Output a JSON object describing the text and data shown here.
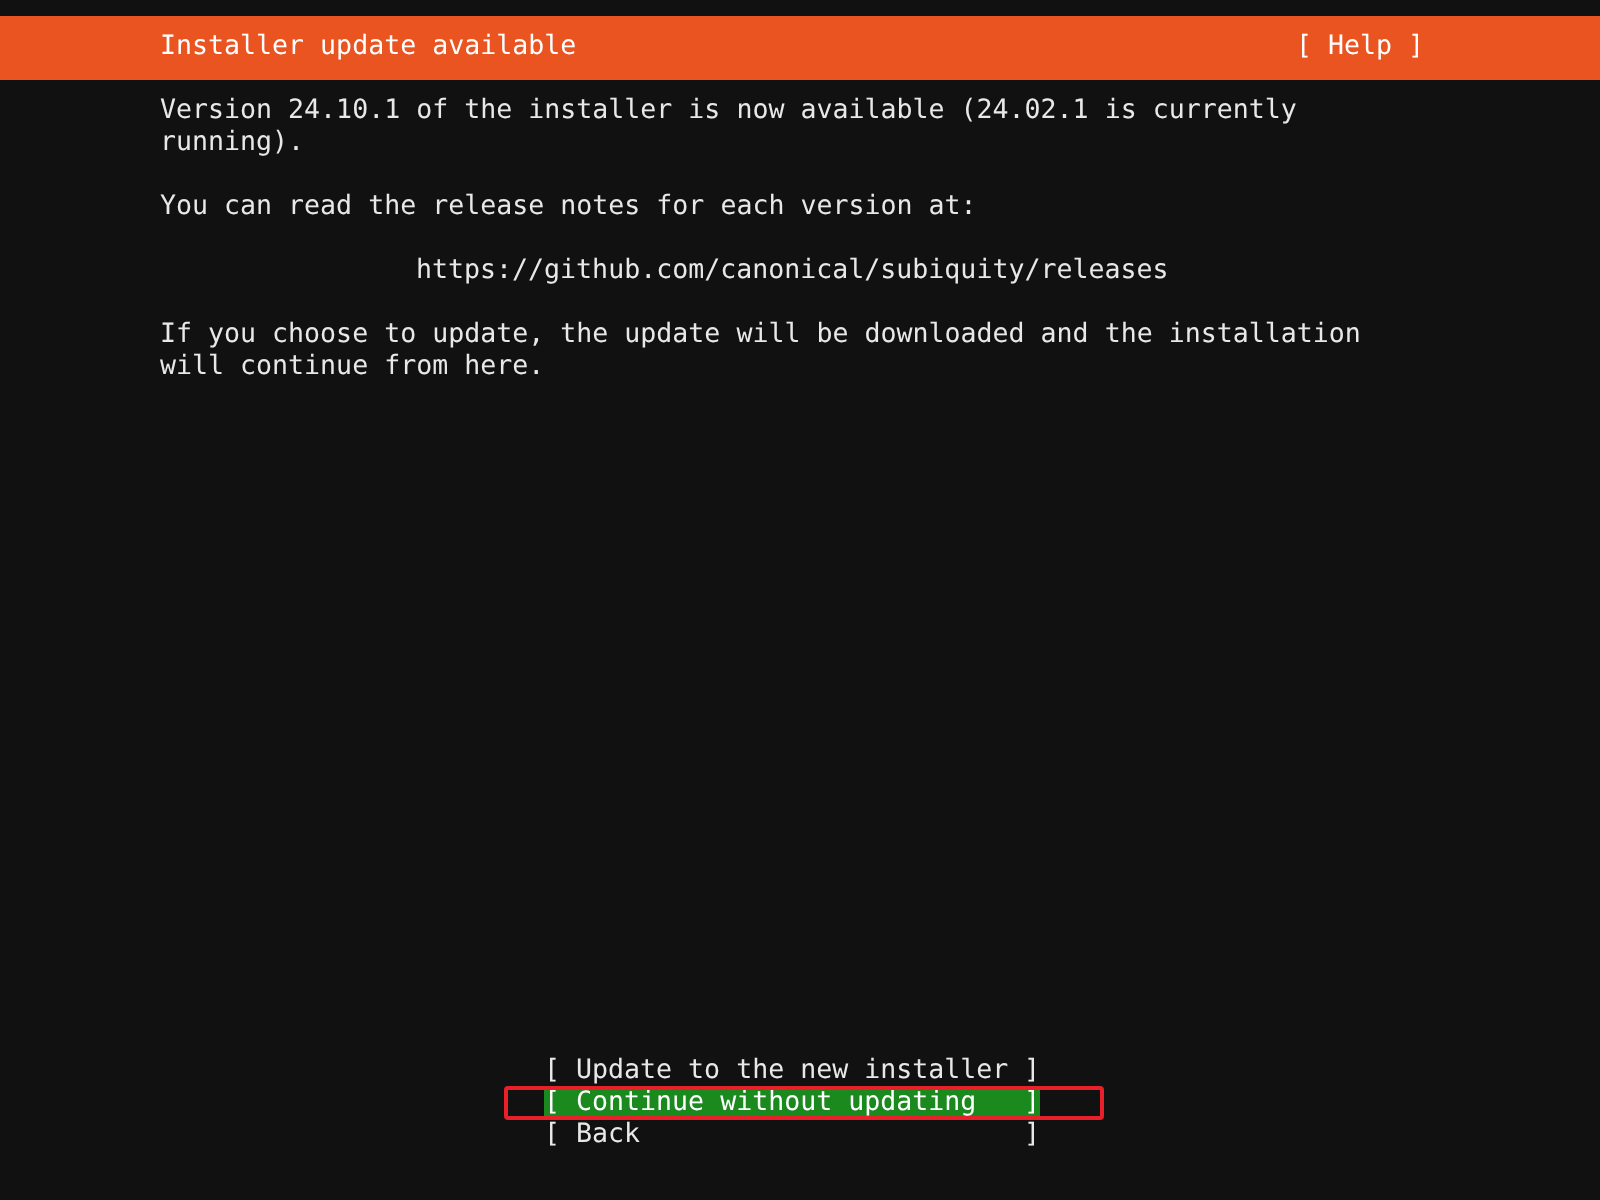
{
  "header": {
    "title": "Installer update available",
    "help": "[ Help ]"
  },
  "body": [
    {
      "kind": "para",
      "text": "Version 24.10.1 of the installer is now available (24.02.1 is currently\nrunning)."
    },
    {
      "kind": "para",
      "text": "You can read the release notes for each version at:"
    },
    {
      "kind": "link",
      "text": "https://github.com/canonical/subiquity/releases"
    },
    {
      "kind": "para",
      "text": "If you choose to update, the update will be downloaded and the installation\nwill continue from here."
    }
  ],
  "buttons": [
    {
      "open": "[",
      "label": "Update to the new installer",
      "close": "]",
      "selected": false
    },
    {
      "open": "[",
      "label": "Continue without updating",
      "close": "]",
      "selected": true
    },
    {
      "open": "[",
      "label": "Back",
      "close": "]",
      "selected": false
    }
  ]
}
